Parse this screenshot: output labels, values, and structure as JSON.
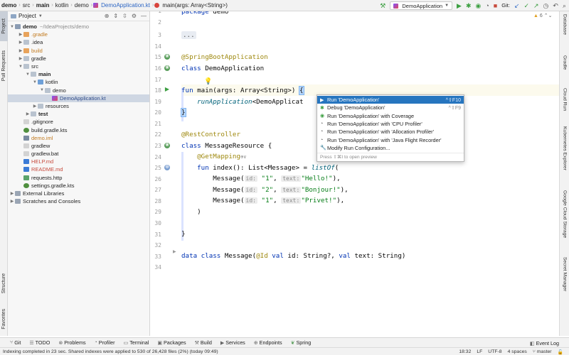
{
  "navbar": {
    "crumbs": [
      "demo",
      "src",
      "main",
      "kotlin",
      "demo",
      "DemoApplication.kt",
      "main(args: Array<String>)"
    ],
    "run_config": "DemoApplication",
    "git_label": "Git:"
  },
  "left_strip": {
    "top_tabs": [
      "Project",
      "Pull Requests"
    ],
    "bottom_tabs": [
      "Structure",
      "Favorites"
    ]
  },
  "project": {
    "title": "Project",
    "tree": [
      {
        "label": "demo",
        "hint": "~/IdeaProjects/demo"
      },
      {
        "label": ".gradle"
      },
      {
        "label": ".idea"
      },
      {
        "label": "build"
      },
      {
        "label": "gradle"
      },
      {
        "label": "src"
      },
      {
        "label": "main"
      },
      {
        "label": "kotlin"
      },
      {
        "label": "demo"
      },
      {
        "label": "DemoApplication.kt"
      },
      {
        "label": "resources"
      },
      {
        "label": "test"
      },
      {
        "label": ".gitignore"
      },
      {
        "label": "build.gradle.kts"
      },
      {
        "label": "demo.iml"
      },
      {
        "label": "gradlew"
      },
      {
        "label": "gradlew.bat"
      },
      {
        "label": "HELP.md"
      },
      {
        "label": "README.md"
      },
      {
        "label": "requests.http"
      },
      {
        "label": "settings.gradle.kts"
      },
      {
        "label": "External Libraries"
      },
      {
        "label": "Scratches and Consoles"
      }
    ]
  },
  "editor": {
    "line_numbers": [
      "1",
      "2",
      "3",
      "14",
      "15",
      "16",
      "17",
      "18",
      "19",
      "20",
      "21",
      "22",
      "23",
      "24",
      "25",
      "26",
      "27",
      "28",
      "29",
      "30",
      "31",
      "32",
      "33",
      "34"
    ],
    "code": {
      "l1_kw": "package",
      "l1_rest": " demo",
      "l3_fold": "...",
      "l15_an": "@SpringBootApplication",
      "l16_kw": "class",
      "l16_rest": " DemoApplication",
      "l18_kw": "fun",
      "l18_rest": " main(args: Array<String>) ",
      "l18_brace": "{",
      "l19_fn": "runApplication",
      "l19_rest": "<DemoApplicat",
      "l20_brace": "}",
      "l22_an": "@RestController",
      "l23_kw": "class",
      "l23_rest": " MessageResource {",
      "l24_an": "@GetMapping",
      "l24_ic": "⊕∨",
      "l25_kw": "fun",
      "l25_rest1": " index(): List<Message> = ",
      "l25_fn": "listOf",
      "l25_rest2": "(",
      "msg": "Message(",
      "p_id": "id:",
      "p_text": "text:",
      "l26_id": "\"1\"",
      "l26_text": "\"Hello!\"",
      "l27_id": "\"2\"",
      "l27_text": "\"Bonjour!\"",
      "l28_id": "\"1\"",
      "l28_text": "\"Privet!\"",
      "sep": ", ",
      "close": "),",
      "close_last": "),",
      "l29": ")",
      "l31": "}",
      "l33_kw1": "data class",
      "l33_a": " Message(",
      "l33_an": "@Id",
      "l33_kw2": " val",
      "l33_b": " id: String?, ",
      "l33_kw3": "val",
      "l33_c": " text: String)"
    },
    "inspection_label": "6"
  },
  "run_menu": {
    "items": [
      {
        "label": "Run 'DemoApplication'",
        "shortcut": "^⇧F10"
      },
      {
        "label": "Debug 'DemoApplication'",
        "shortcut": "^⇧F9"
      },
      {
        "label": "Run 'DemoApplication' with Coverage",
        "shortcut": ""
      },
      {
        "label": "Run 'DemoApplication' with 'CPU Profiler'",
        "shortcut": ""
      },
      {
        "label": "Run 'DemoApplication' with 'Allocation Profiler'",
        "shortcut": ""
      },
      {
        "label": "Run 'DemoApplication' with 'Java Flight Recorder'",
        "shortcut": ""
      },
      {
        "label": "Modify Run Configuration...",
        "shortcut": ""
      }
    ],
    "footer": "Press ⇧⌘I to open preview"
  },
  "right_strip": {
    "tabs": [
      "Database",
      "Gradle",
      "Cloud Run",
      "Kubernetes Explorer",
      "Google Cloud Storage",
      "Secret Manager"
    ]
  },
  "bottom_tabs": {
    "items": [
      "Git",
      "TODO",
      "Problems",
      "Profiler",
      "Terminal",
      "Packages",
      "Build",
      "Services",
      "Endpoints",
      "Spring"
    ],
    "event_log": "Event Log"
  },
  "status": {
    "message": "Indexing completed in 23 sec. Shared indexes were applied to 530 of 26,428 files (2%) (today 09:49)",
    "position": "18:32",
    "line_sep": "LF",
    "encoding": "UTF-8",
    "indent": "4 spaces",
    "branch": "master"
  }
}
